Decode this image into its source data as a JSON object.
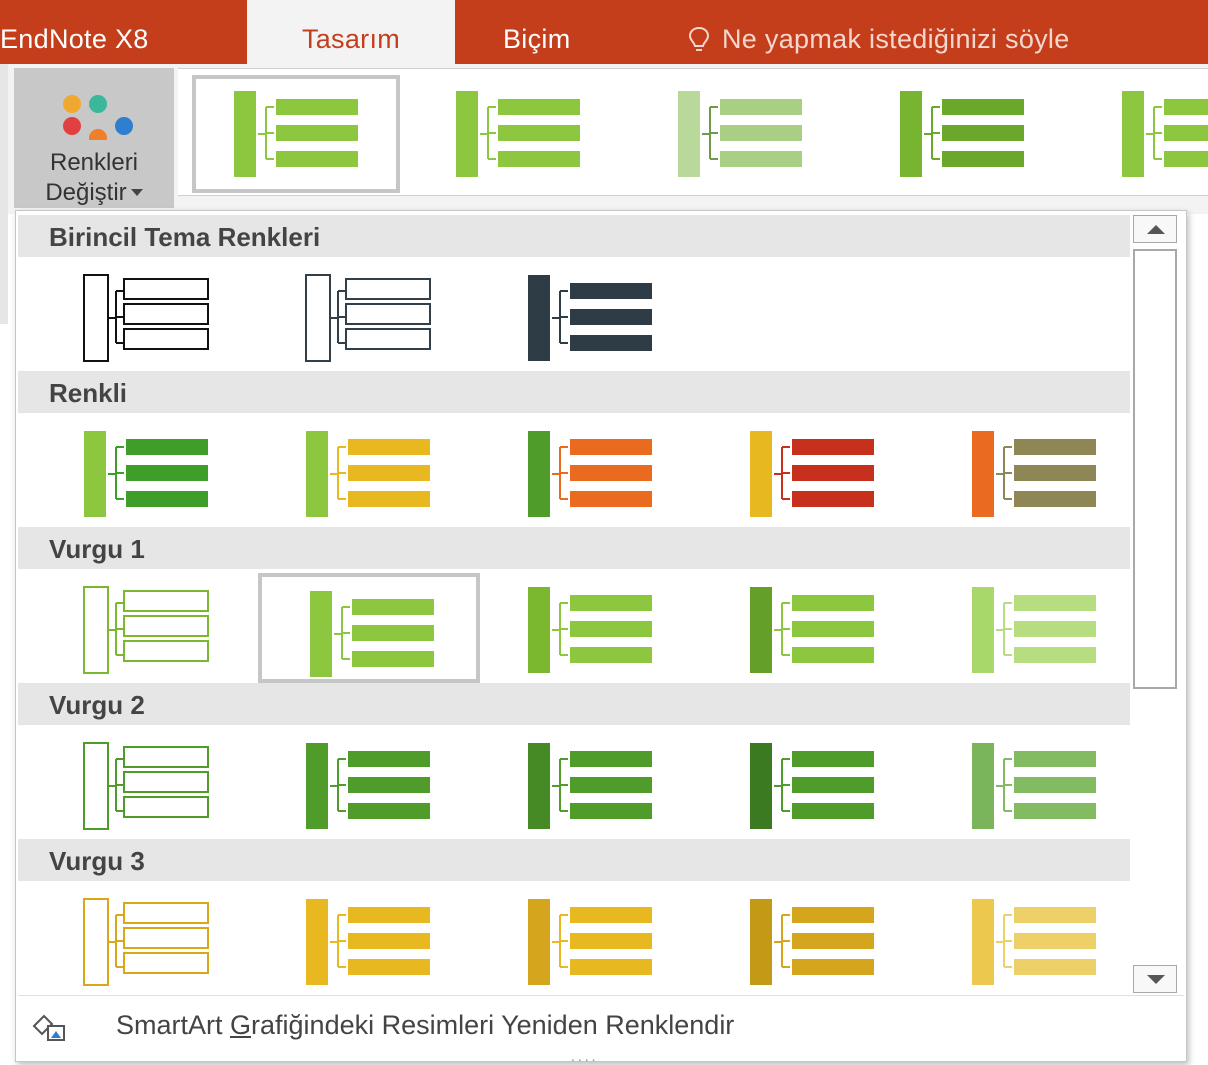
{
  "tabs": {
    "endnote": "EndNote X8",
    "tasarim": "Tasarım",
    "bicim": "Biçim",
    "tellme": "Ne yapmak istediğinizi söyle"
  },
  "ribbon": {
    "change_colors_line1": "Renkleri",
    "change_colors_line2": "Değiştir"
  },
  "panel": {
    "sections": [
      {
        "title": "Birincil Tema Renkleri"
      },
      {
        "title": "Renkli"
      },
      {
        "title": "Vurgu 1"
      },
      {
        "title": "Vurgu 2"
      },
      {
        "title": "Vurgu 3"
      }
    ],
    "footer": {
      "pre": "SmartArt ",
      "accel": "G",
      "post": "rafiğindeki Resimleri Yeniden Renklendir"
    }
  },
  "colors": {
    "tab_bar": "#c43e1c",
    "ribbon": "#f3f3f3",
    "selection": "#c6c6c6",
    "section_bg": "#e6e6e6"
  },
  "icons": [
    "lightbulb-icon",
    "change-colors-icon",
    "recolor-pictures-icon",
    "scroll-up-icon",
    "scroll-down-icon"
  ]
}
